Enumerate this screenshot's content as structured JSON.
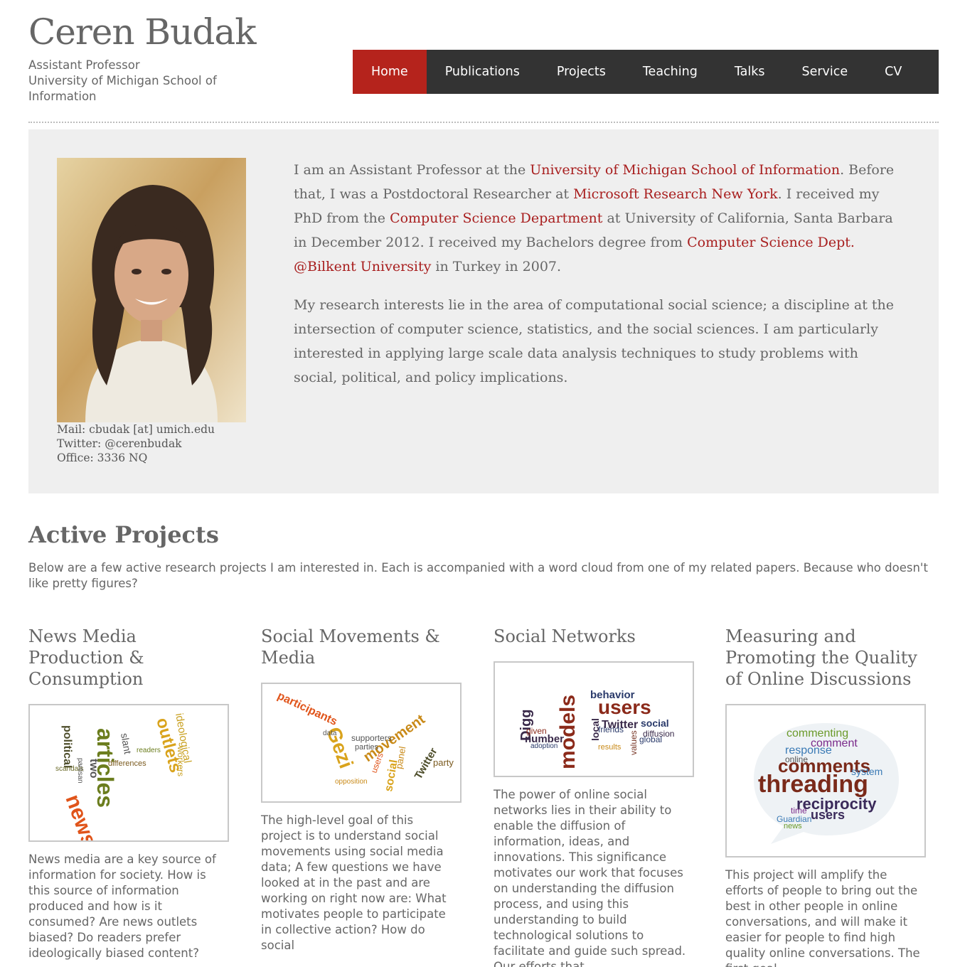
{
  "site": {
    "title": "Ceren Budak",
    "subtitle": "Assistant Professor\nUniversity of Michigan School of Information"
  },
  "nav": {
    "items": [
      {
        "label": "Home",
        "active": true
      },
      {
        "label": "Publications"
      },
      {
        "label": "Projects"
      },
      {
        "label": "Teaching"
      },
      {
        "label": "Talks"
      },
      {
        "label": "Service"
      },
      {
        "label": "CV"
      }
    ]
  },
  "intro": {
    "contact": {
      "mail": "Mail: cbudak [at] umich.edu",
      "twitter": "Twitter: @cerenbudak",
      "office": "Office: 3336 NQ"
    },
    "bio1": {
      "t1": "I am an Assistant Professor at the ",
      "l1": "University of Michigan School of Information",
      "t2": ". Before that, I was a Postdoctoral Researcher at ",
      "l2": "Microsoft Research New York",
      "t3": ". I received my PhD from the ",
      "l3": "Computer Science Department",
      "t4": " at University of California, Santa Barbara in December 2012. I received my Bachelors degree from ",
      "l4": "Computer Science Dept. @Bilkent University",
      "t5": " in Turkey in 2007."
    },
    "bio2": "My research interests lie in the area of computational social science; a discipline at the intersection of computer science, statistics, and the social sciences. I am particularly interested in applying large scale data analysis techniques to study problems with social, political, and policy implications."
  },
  "active_projects": {
    "title": "Active Projects",
    "description": "Below are a few active research projects I am interested in. Each is accompanied with a word cloud from one of my related papers. Because who doesn't like pretty figures?"
  },
  "projects": [
    {
      "title": "News Media Production & Consumption",
      "description": "News media are a key source of information for society. How is this source of information produced and how is it consumed? Are news outlets biased? Do readers prefer ideologically biased content?",
      "cloud_words": [
        "articles",
        "news",
        "outlets",
        "ideological",
        "political",
        "slant",
        "differences",
        "workers",
        "two",
        "readers",
        "scandals",
        "partisan"
      ]
    },
    {
      "title": "Social Movements & Media",
      "description": "The high-level goal of this project is to understand social movements using social media data; A few questions we have looked at in the past and are working on right now are: What motivates people to participate in collective action? How do social",
      "cloud_words": [
        "participants",
        "Gezi",
        "movement",
        "Twitter",
        "party",
        "supporters",
        "parties",
        "social",
        "users",
        "opposition",
        "panel",
        "data"
      ]
    },
    {
      "title": "Social Networks",
      "description": "The power of online social networks lies in their ability to enable the diffusion of information, ideas, and innovations. This significance motivates our work that focuses on understanding the diffusion process, and using this understanding to build technological solutions to facilitate and guide such spread. Our efforts that",
      "cloud_words": [
        "models",
        "users",
        "Digg",
        "Twitter",
        "behavior",
        "social",
        "diffusion",
        "friends",
        "number",
        "local",
        "values",
        "results",
        "adoption",
        "given",
        "global"
      ]
    },
    {
      "title": "Measuring and Promoting the Quality of Online Discussions",
      "description": "This project will amplify the efforts of people to bring out the best in other people in online conversations, and will make it easier for people to find high quality online conversations. The first goal",
      "cloud_words": [
        "threading",
        "comments",
        "reciprocity",
        "commenting",
        "response",
        "users",
        "comment",
        "system",
        "Guardian",
        "online",
        "time",
        "news"
      ]
    }
  ],
  "colors": {
    "accent": "#b5231c",
    "nav_bg": "#333333",
    "link": "#a81e1e",
    "intro_bg": "#efefef"
  }
}
